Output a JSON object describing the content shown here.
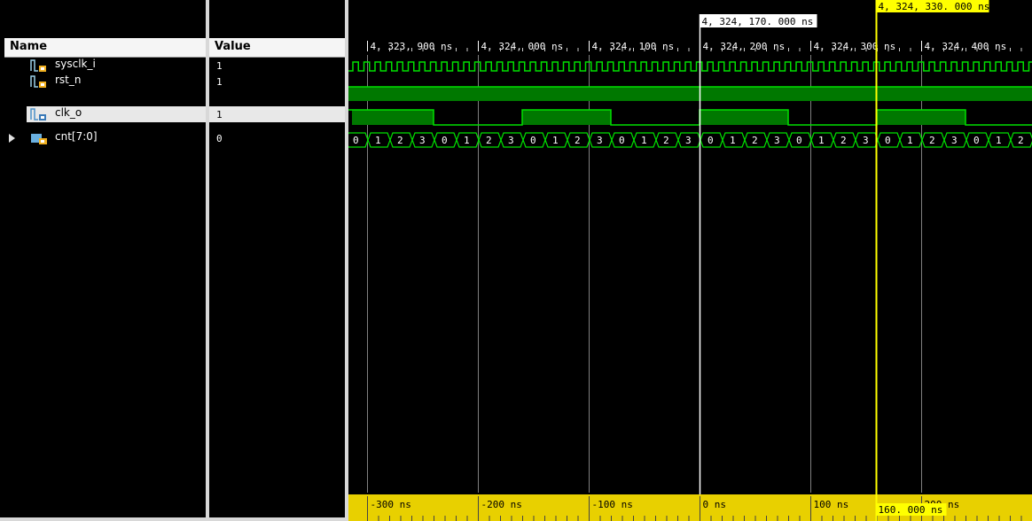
{
  "header": {
    "name_label": "Name",
    "value_label": "Value"
  },
  "signals": [
    {
      "name": "sysclk_i",
      "value": "1",
      "icon": "clock-signal-icon",
      "selected": false
    },
    {
      "name": "rst_n",
      "value": "1",
      "icon": "reset-signal-icon",
      "selected": false
    },
    {
      "name": "clk_o",
      "value": "1",
      "icon": "output-signal-icon",
      "selected": true
    },
    {
      "name": "cnt[7:0]",
      "value": "0",
      "icon": "bus-signal-icon",
      "selected": false,
      "expandable": true
    }
  ],
  "waveform": {
    "timeline_labels": [
      "4, 323, 900 ns",
      "4, 324, 000 ns",
      "4, 324, 100 ns",
      "4, 324, 200 ns",
      "4, 324, 300 ns",
      "4, 324, 400 ns"
    ],
    "cursor_main": {
      "label": "4, 324, 330. 000 ns",
      "color": "#ffff00"
    },
    "cursor_marker": {
      "label": "4, 324, 170. 000 ns",
      "color": "#ffffff"
    },
    "delta_label": "160. 000 ns",
    "ruler_labels": [
      "-300 ns",
      "-200 ns",
      "-100 ns",
      "0 ns",
      "100 ns",
      "200 ns"
    ],
    "cnt_values": [
      "0",
      "1",
      "2",
      "3",
      "0",
      "1",
      "2",
      "3",
      "0",
      "1",
      "2",
      "3",
      "0",
      "1",
      "2",
      "3",
      "0",
      "1",
      "2",
      "3",
      "0",
      "1",
      "2",
      "3",
      "0",
      "1",
      "2",
      "3",
      "0",
      "1",
      "2"
    ],
    "colors": {
      "wave": "#00e000",
      "fill": "#007800",
      "ruler": "#e8d000",
      "grid": "#808080"
    }
  }
}
